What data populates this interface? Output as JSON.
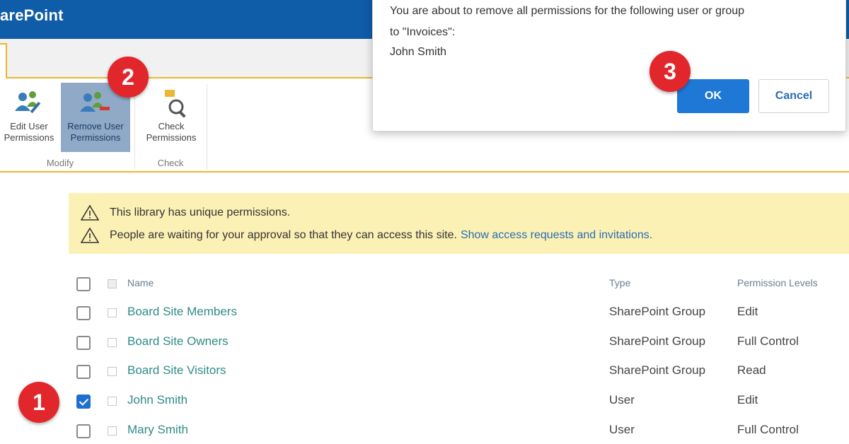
{
  "app": {
    "brand": "arePoint"
  },
  "ribbon": {
    "buttons": [
      {
        "label1": "Edit User",
        "label2": "Permissions",
        "icon": "edit-user-permissions-icon"
      },
      {
        "label1": "Remove User",
        "label2": "Permissions",
        "icon": "remove-user-permissions-icon"
      },
      {
        "label1": "Check",
        "label2": "Permissions",
        "icon": "check-permissions-icon"
      }
    ],
    "groups": [
      {
        "label": "Modify"
      },
      {
        "label": "Check"
      }
    ]
  },
  "banner": {
    "line1": "This library has unique permissions.",
    "line2": "People are waiting for your approval so that they can access this site.",
    "link": "Show access requests and invitations."
  },
  "table": {
    "headers": {
      "name": "Name",
      "type": "Type",
      "permission": "Permission Levels"
    },
    "rows": [
      {
        "name": "Board Site Members",
        "type": "SharePoint Group",
        "permission": "Edit",
        "checked": false
      },
      {
        "name": "Board Site Owners",
        "type": "SharePoint Group",
        "permission": "Full Control",
        "checked": false
      },
      {
        "name": "Board Site Visitors",
        "type": "SharePoint Group",
        "permission": "Read",
        "checked": false
      },
      {
        "name": "John Smith",
        "type": "User",
        "permission": "Edit",
        "checked": true
      },
      {
        "name": "Mary Smith",
        "type": "User",
        "permission": "Full Control",
        "checked": false
      }
    ]
  },
  "dialog": {
    "line1": "You are about to remove all permissions for the following user or group",
    "line2": "to \"Invoices\":",
    "line3": "John Smith",
    "ok": "OK",
    "cancel": "Cancel"
  },
  "steps": {
    "s1": "1",
    "s2": "2",
    "s3": "3"
  },
  "colors": {
    "suitebar": "#0f5ca8",
    "accent": "#f0b429",
    "link": "#2f8b87",
    "banner": "#fbf1b5",
    "ok": "#1f78d6",
    "marker": "#e2272c"
  }
}
